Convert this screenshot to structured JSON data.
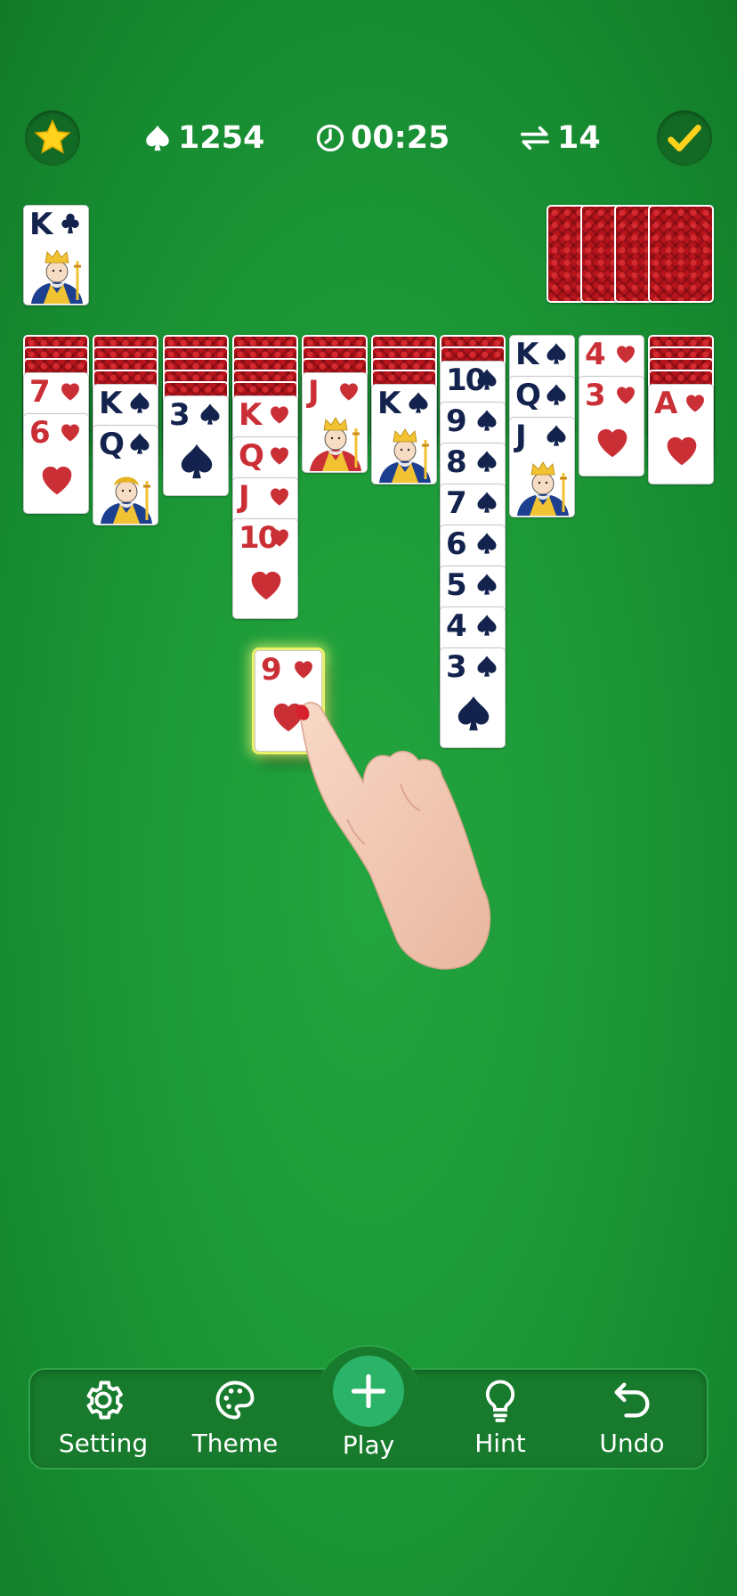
{
  "header": {
    "score": "1254",
    "time": "00:25",
    "moves": "14",
    "left_icon": "star-icon",
    "right_icon": "checkmark-icon"
  },
  "completed_suit": {
    "rank": "K",
    "suit": "clubs"
  },
  "stock": {
    "face_down_piles": 4
  },
  "tableau": [
    {
      "hidden": 3,
      "cards": [
        {
          "rank": "7",
          "suit": "hearts"
        },
        {
          "rank": "6",
          "suit": "hearts"
        }
      ]
    },
    {
      "hidden": 4,
      "cards": [
        {
          "rank": "K",
          "suit": "spades"
        },
        {
          "rank": "Q",
          "suit": "spades"
        }
      ]
    },
    {
      "hidden": 5,
      "cards": [
        {
          "rank": "3",
          "suit": "spades"
        }
      ]
    },
    {
      "hidden": 5,
      "cards": [
        {
          "rank": "K",
          "suit": "hearts"
        },
        {
          "rank": "Q",
          "suit": "hearts"
        },
        {
          "rank": "J",
          "suit": "hearts"
        },
        {
          "rank": "10",
          "suit": "hearts"
        }
      ]
    },
    {
      "hidden": 3,
      "cards": [
        {
          "rank": "J",
          "suit": "hearts"
        }
      ]
    },
    {
      "hidden": 4,
      "cards": [
        {
          "rank": "K",
          "suit": "spades"
        }
      ]
    },
    {
      "hidden": 2,
      "cards": [
        {
          "rank": "10",
          "suit": "spades"
        },
        {
          "rank": "9",
          "suit": "spades"
        },
        {
          "rank": "8",
          "suit": "spades"
        },
        {
          "rank": "7",
          "suit": "spades"
        },
        {
          "rank": "6",
          "suit": "spades"
        },
        {
          "rank": "5",
          "suit": "spades"
        },
        {
          "rank": "4",
          "suit": "spades"
        },
        {
          "rank": "3",
          "suit": "spades"
        }
      ]
    },
    {
      "hidden": 0,
      "cards": [
        {
          "rank": "K",
          "suit": "spades"
        },
        {
          "rank": "Q",
          "suit": "spades"
        },
        {
          "rank": "J",
          "suit": "spades"
        }
      ]
    },
    {
      "hidden": 0,
      "cards": [
        {
          "rank": "4",
          "suit": "hearts"
        },
        {
          "rank": "3",
          "suit": "hearts"
        }
      ]
    },
    {
      "hidden": 4,
      "cards": [
        {
          "rank": "A",
          "suit": "hearts"
        }
      ]
    }
  ],
  "dragged_card": {
    "rank": "9",
    "suit": "hearts"
  },
  "toolbar": {
    "setting_label": "Setting",
    "theme_label": "Theme",
    "play_label": "Play",
    "hint_label": "Hint",
    "undo_label": "Undo"
  },
  "colors": {
    "felt": "#1d9a38",
    "red_suit": "#cb2f36",
    "black_suit": "#13234d",
    "card_back": "#b8141c",
    "play_button": "#2bb36a"
  }
}
